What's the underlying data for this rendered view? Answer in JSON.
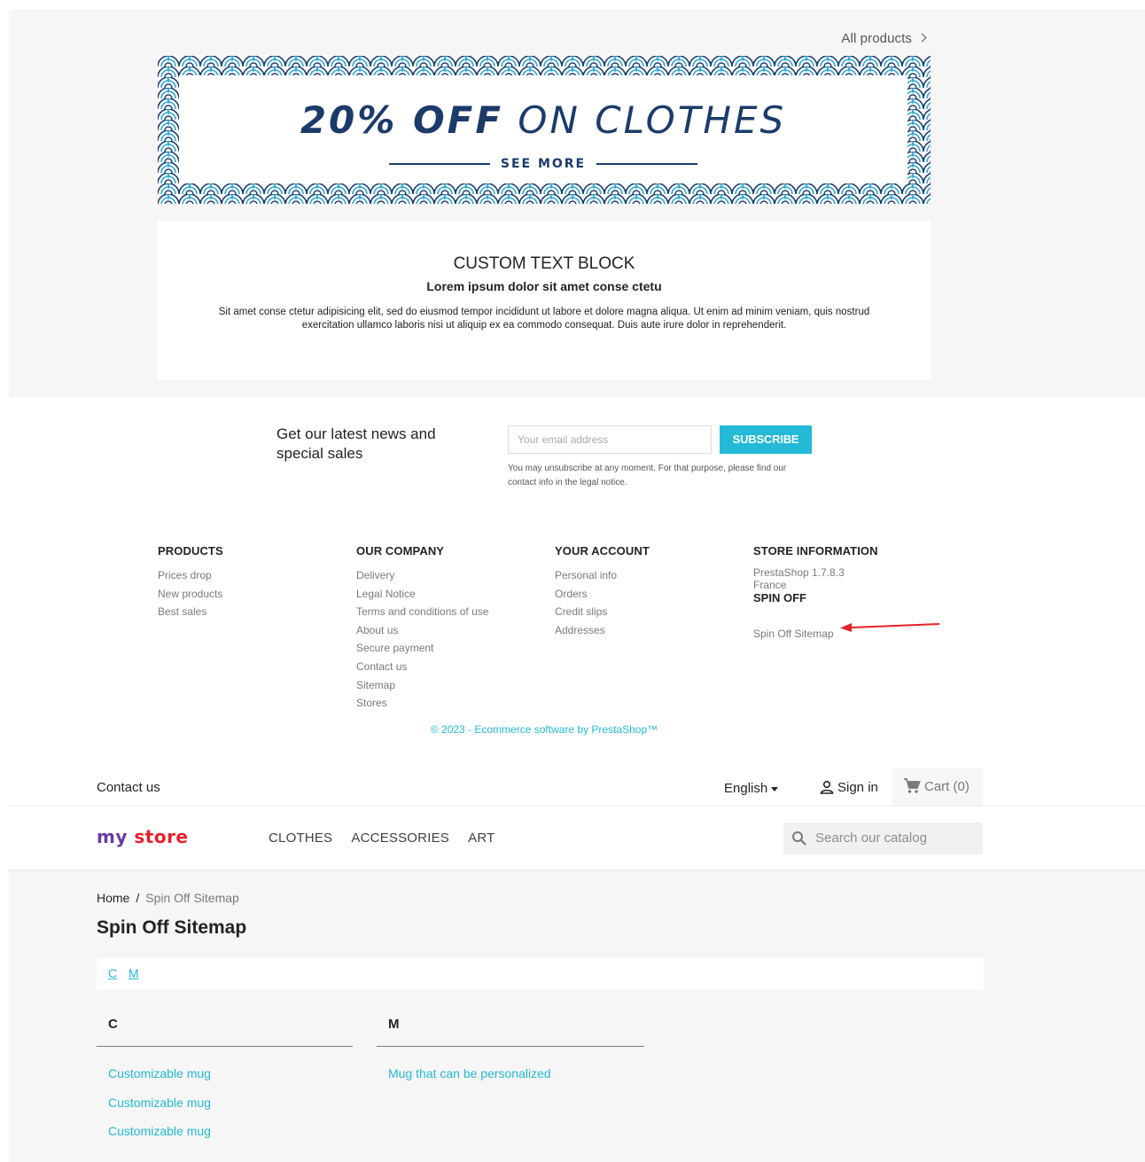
{
  "home_section": {
    "all_products_label": "All products",
    "banner": {
      "headline_bold": "20% OFF",
      "headline_light": "ON CLOTHES",
      "cta": "SEE MORE"
    },
    "custom_text": {
      "title": "CUSTOM TEXT BLOCK",
      "subtitle": "Lorem ipsum dolor sit amet conse ctetu",
      "body": "Sit amet conse ctetur adipisicing elit, sed do eiusmod tempor incididunt ut labore et dolore magna aliqua. Ut enim ad minim veniam, quis nostrud exercitation ullamco laboris nisi ut aliquip ex ea commodo consequat. Duis aute irure dolor in reprehenderit."
    }
  },
  "newsletter": {
    "title": "Get our latest news and special sales",
    "email_placeholder": "Your email address",
    "subscribe_label": "SUBSCRIBE",
    "note": "You may unsubscribe at any moment. For that purpose, please find our contact info in the legal notice."
  },
  "footer": {
    "products": {
      "title": "PRODUCTS",
      "links": [
        "Prices drop",
        "New products",
        "Best sales"
      ]
    },
    "company": {
      "title": "OUR COMPANY",
      "links": [
        "Delivery",
        "Legal Notice",
        "Terms and conditions of use",
        "About us",
        "Secure payment",
        "Contact us",
        "Sitemap",
        "Stores"
      ]
    },
    "account": {
      "title": "YOUR ACCOUNT",
      "links": [
        "Personal info",
        "Orders",
        "Credit slips",
        "Addresses"
      ]
    },
    "store": {
      "title": "STORE INFORMATION",
      "line1": "PrestaShop 1.7.8.3",
      "line2": "France",
      "spin_off_title": "SPIN OFF",
      "spin_off_link": "Spin Off Sitemap"
    },
    "copyright": "© 2023 - Ecommerce software by PrestaShop™",
    "annotation_color": "#e8202a"
  },
  "header": {
    "contact_label": "Contact us",
    "language": "English",
    "signin_label": "Sign in",
    "cart_label": "Cart (0)",
    "logo": {
      "part1": "my",
      "part2": "store"
    },
    "nav": [
      "CLOTHES",
      "ACCESSORIES",
      "ART"
    ],
    "search_placeholder": "Search our catalog"
  },
  "page": {
    "breadcrumb": {
      "home": "Home",
      "separator": "/",
      "current": "Spin Off Sitemap"
    },
    "title": "Spin Off Sitemap",
    "letters": [
      "C",
      "M"
    ],
    "groups": [
      {
        "letter": "C",
        "items": [
          "Customizable mug",
          "Customizable mug",
          "Customizable mug"
        ]
      },
      {
        "letter": "M",
        "items": [
          "Mug that can be personalized"
        ]
      }
    ]
  },
  "colors": {
    "accent": "#24b9d7",
    "banner_navy": "#1c3b6b",
    "background_grey": "#f6f6f6"
  }
}
